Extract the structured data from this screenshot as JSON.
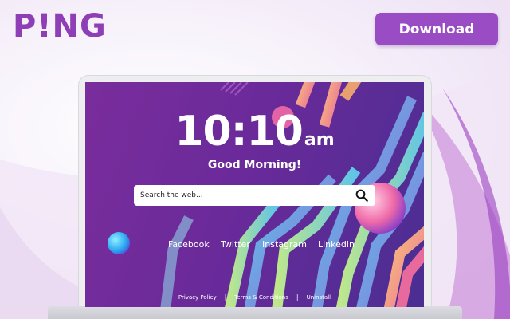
{
  "brand": {
    "logo_text": "P!NG",
    "color": "#8e3fb5"
  },
  "header": {
    "download_label": "Download",
    "button_color": "#9a4cc4"
  },
  "newtab": {
    "time": "10:10",
    "ampm": "am",
    "greeting": "Good Morning!",
    "search_placeholder": "Search the web...",
    "social_links": [
      "Facebook",
      "Twitter",
      "Instagram",
      "Linkedin"
    ],
    "footer_links": [
      "Privacy Policy",
      "Terms & Conditions",
      "Uninstall"
    ],
    "footer_separator": "|"
  },
  "icons": {
    "search": "search-icon"
  }
}
